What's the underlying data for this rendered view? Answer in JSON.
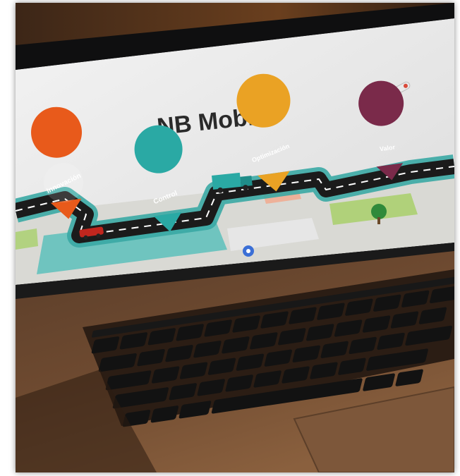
{
  "slide": {
    "title": "NB Mobile",
    "pins": [
      {
        "label": "Innovación",
        "color": "#e85a1b"
      },
      {
        "label": "Control",
        "color": "#2aa9a4"
      },
      {
        "label": "Optimización",
        "color": "#eaa224"
      },
      {
        "label": "Valor",
        "color": "#7a2a4a"
      }
    ]
  },
  "icons": [
    "airplane-icon",
    "truck-icon",
    "car-icon",
    "tree-icon",
    "location-pin-icon"
  ],
  "colors": {
    "screen_bg": "#ececec",
    "road": "#1b1b1b",
    "map_teal": "#3aa9a4",
    "keyboard_base": "#4a3324",
    "key": "#141414"
  }
}
